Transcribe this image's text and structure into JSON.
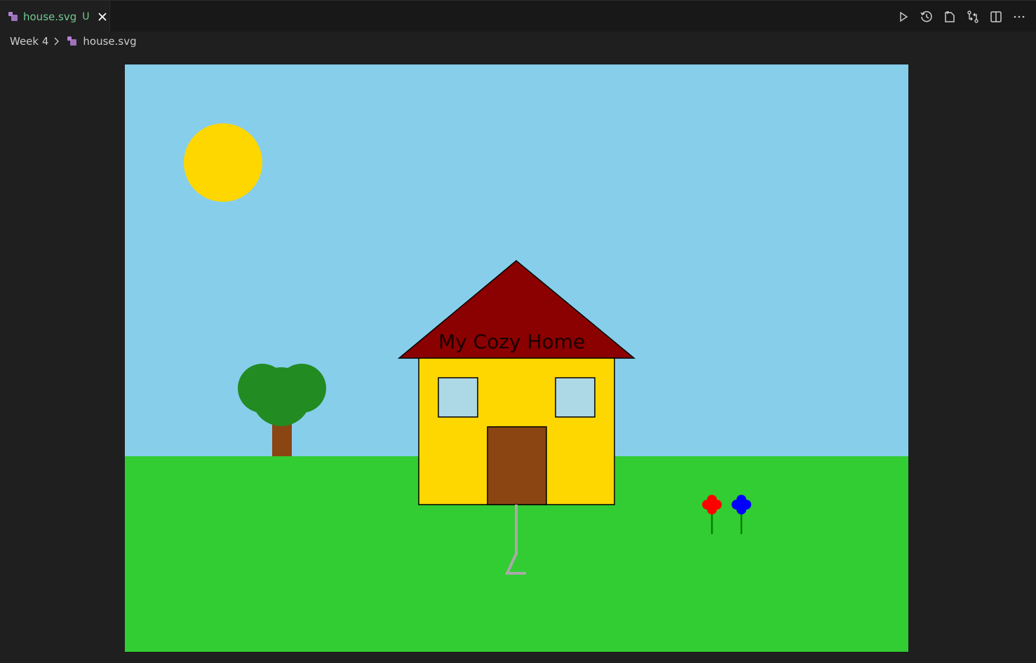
{
  "tab": {
    "filename": "house.svg",
    "status": "U",
    "icon": "svg-file-icon",
    "close_icon": "close-icon"
  },
  "editor_actions": [
    {
      "name": "run-button",
      "icon": "play-icon"
    },
    {
      "name": "timeline-button",
      "icon": "history-icon"
    },
    {
      "name": "open-changes-button",
      "icon": "file-icon"
    },
    {
      "name": "compare-changes-button",
      "icon": "git-compare-icon"
    },
    {
      "name": "split-editor-button",
      "icon": "split-editor-icon"
    },
    {
      "name": "more-actions-button",
      "icon": "ellipsis-icon"
    }
  ],
  "breadcrumb": {
    "folder": "Week 4",
    "file": "house.svg"
  },
  "drawing": {
    "roof_text": "My Cozy Home",
    "colors": {
      "sky": "#87ceeb",
      "grass": "#32cd32",
      "sun": "#ffd700",
      "house_wall": "#ffd700",
      "roof": "#8b0000",
      "window": "#add8e6",
      "door": "#8b4513",
      "tree_trunk": "#8b4513",
      "tree_leaves": "#228b22",
      "path": "#a9a9a9",
      "flower_red": "#ff0000",
      "flower_blue": "#0000ff",
      "stem": "#008000"
    }
  },
  "theme": {
    "background": "#1f1f1f",
    "tabbar": "#181818",
    "modified_text": "#73c991"
  }
}
